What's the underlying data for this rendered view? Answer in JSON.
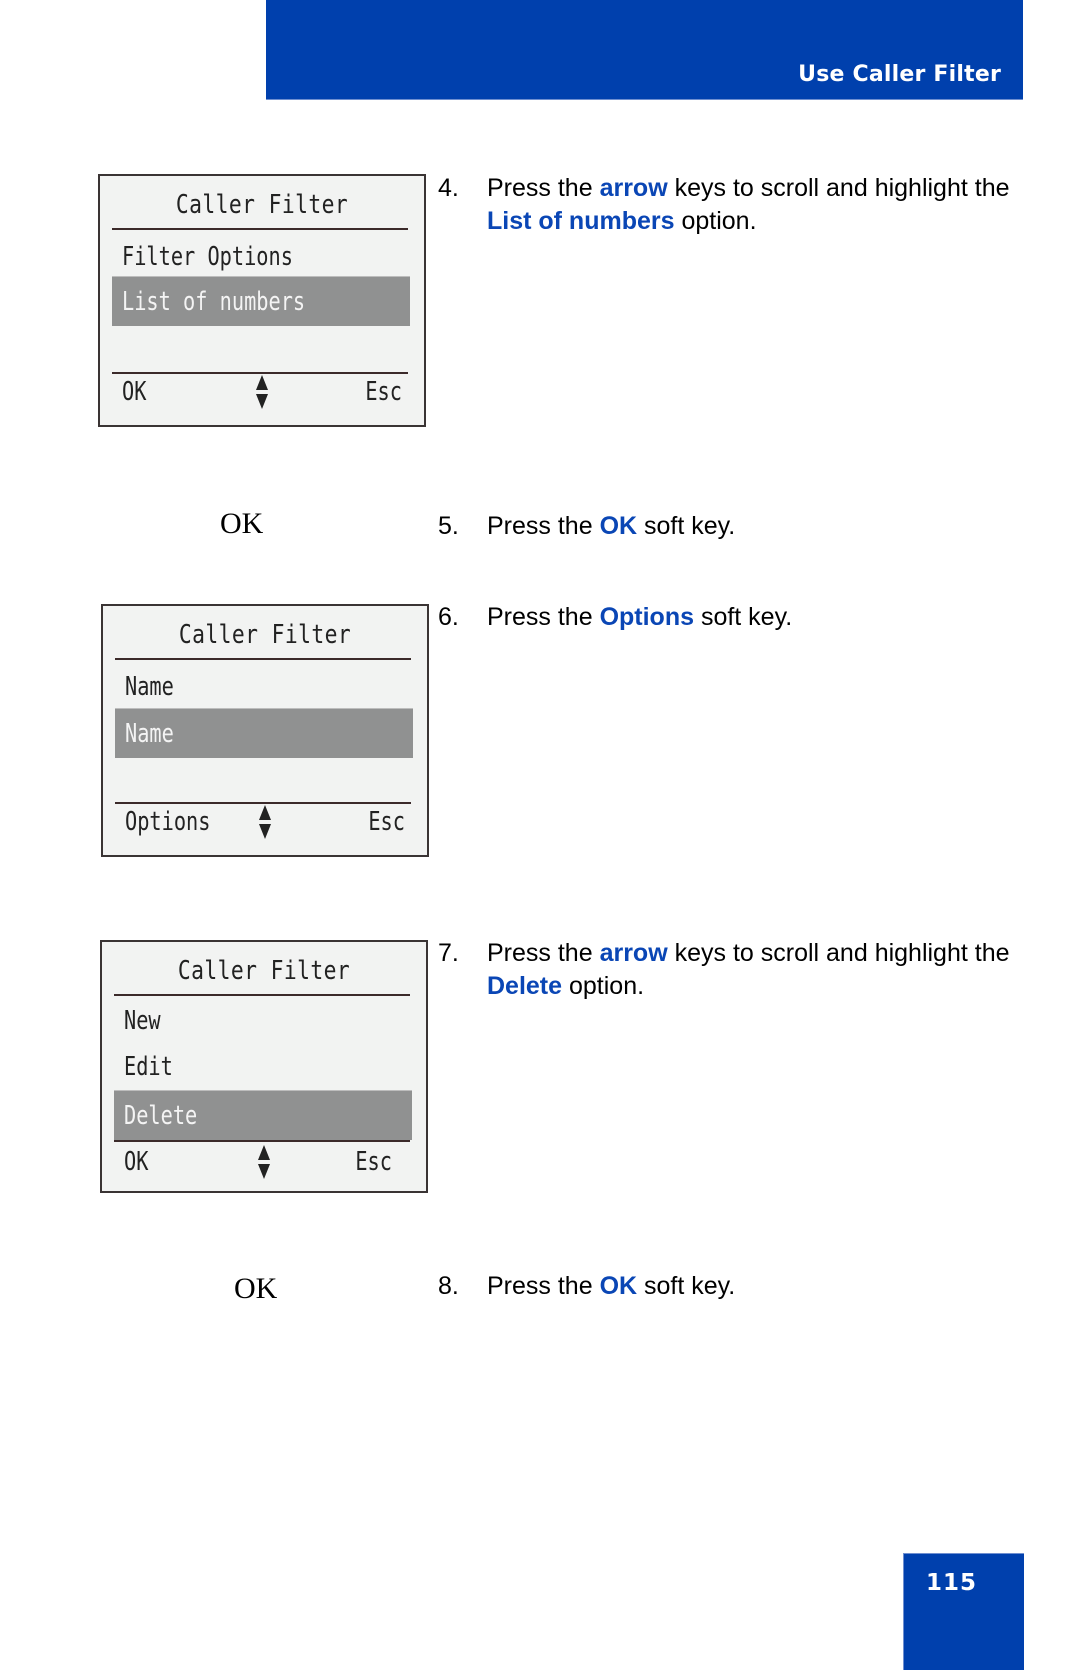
{
  "header": {
    "title": "Use Caller Filter"
  },
  "page_number": "115",
  "screens": [
    {
      "title": "Caller Filter",
      "items": [
        {
          "label": "Filter Options",
          "highlighted": false
        },
        {
          "label": "List of numbers",
          "highlighted": true
        }
      ],
      "softkeys": {
        "left": "OK",
        "right": "Esc"
      }
    },
    {
      "title": "Caller Filter",
      "items": [
        {
          "label": "Name",
          "highlighted": false
        },
        {
          "label": "Name",
          "highlighted": true
        }
      ],
      "softkeys": {
        "left": "Options",
        "right": "Esc"
      }
    },
    {
      "title": "Caller Filter",
      "items": [
        {
          "label": "New",
          "highlighted": false
        },
        {
          "label": "Edit",
          "highlighted": false
        },
        {
          "label": "Delete",
          "highlighted": true
        }
      ],
      "softkeys": {
        "left": "OK",
        "right": "Esc"
      }
    }
  ],
  "key_labels": {
    "ok_1": "OK",
    "ok_2": "OK"
  },
  "steps": [
    {
      "num": "4.",
      "parts": [
        "Press the ",
        "arrow",
        " keys to scroll and highlight the ",
        "List of numbers",
        " option."
      ]
    },
    {
      "num": "5.",
      "parts": [
        "Press the ",
        "OK",
        " soft key."
      ]
    },
    {
      "num": "6.",
      "parts": [
        "Press the ",
        "Options",
        " soft key."
      ]
    },
    {
      "num": "7.",
      "parts": [
        "Press the ",
        "arrow",
        " keys to scroll and highlight the ",
        "Delete",
        " option."
      ]
    },
    {
      "num": "8.",
      "parts": [
        "Press the ",
        "OK",
        " soft key."
      ]
    }
  ],
  "colors": {
    "brand_blue": "#0040ad",
    "keyword_blue": "#0a46b5",
    "highlight_gray": "#909191"
  }
}
